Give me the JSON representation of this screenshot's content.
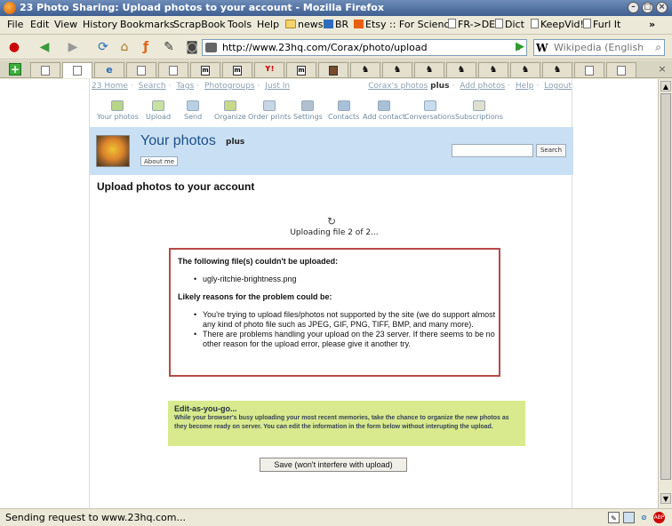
{
  "window": {
    "title": "23 Photo Sharing: Upload photos to your account - Mozilla Firefox",
    "min_glyph": "–",
    "max_glyph": "□",
    "close_glyph": "×"
  },
  "menu": {
    "file": "File",
    "edit": "Edit",
    "view": "View",
    "history": "History",
    "bookmarks": "Bookmarks",
    "scrapbook": "ScrapBook",
    "tools": "Tools",
    "help": "Help",
    "overflow": "»"
  },
  "bookmarks": [
    {
      "label": "news",
      "icon": "folder-icon"
    },
    {
      "label": "BR",
      "icon": "br-icon"
    },
    {
      "label": "Etsy :: For Science",
      "icon": "etsy-icon"
    },
    {
      "label": "FR->DE",
      "icon": "page-icon"
    },
    {
      "label": "Dict",
      "icon": "page-icon"
    },
    {
      "label": "KeepVid!",
      "icon": "page-icon"
    },
    {
      "label": "Furl It",
      "icon": "page-icon"
    }
  ],
  "navigation": {
    "url": "http://www.23hq.com/Corax/photo/upload",
    "search_engine_glyph": "W",
    "search_placeholder": "Wikipedia (English)"
  },
  "tabs": {
    "new_tab_glyph": "+",
    "close_glyph": "×",
    "icons": [
      "page",
      "page",
      "ie",
      "page",
      "page",
      "m",
      "m",
      "y",
      "m",
      "film",
      "dog",
      "dog",
      "dog",
      "dog",
      "dog",
      "dog",
      "dog",
      "page",
      "page"
    ],
    "icon_glyphs": {
      "ie": "e",
      "m": "m",
      "y": "Y!",
      "dog": "♞"
    }
  },
  "site": {
    "toplinks_left": [
      "23 Home",
      "Search",
      "Tags",
      "Photogroups",
      "Just In"
    ],
    "toplinks_right": {
      "user": "Corax's photos",
      "plus": "plus",
      "links": [
        "Add photos",
        "Help",
        "Logout"
      ]
    },
    "nav": [
      {
        "label": "Your photos",
        "icon": "photos-icon",
        "color": "#b9d58a"
      },
      {
        "label": "Upload",
        "icon": "upload-arrow-icon",
        "color": "#c8e0a0"
      },
      {
        "label": "Send",
        "icon": "send-icon",
        "color": "#b9d0e4"
      },
      {
        "label": "Organize",
        "icon": "organize-icon",
        "color": "#c8d88a"
      },
      {
        "label": "Order prints",
        "icon": "prints-icon",
        "color": "#c6d6e6"
      },
      {
        "label": "Settings",
        "icon": "settings-lock-icon",
        "color": "#b0c0d0"
      },
      {
        "label": "Contacts",
        "icon": "contacts-icon",
        "color": "#a8c0d8"
      },
      {
        "label": "Add contact",
        "icon": "add-contact-icon",
        "color": "#a8c0d8"
      },
      {
        "label": "Conversations",
        "icon": "conversations-icon",
        "color": "#c8dcef"
      },
      {
        "label": "Subscriptions",
        "icon": "subscriptions-icon",
        "color": "#e0e0d0"
      }
    ],
    "hero": {
      "title": "Your photos",
      "plus": "plus",
      "about": "About me",
      "search_button": "Search"
    },
    "heading": "Upload photos to your account",
    "spinner_glyph": "↻",
    "progress": "Uploading file 2 of 2...",
    "error": {
      "title": "The following file(s) couldn't be uploaded:",
      "files": [
        "ugly-ritchie-brightness.png"
      ],
      "reasons_title": "Likely reasons for the problem could be:",
      "reasons": [
        "You're trying to upload files/photos not supported by the site (we do support almost any kind of photo file such as JPEG, GIF, PNG, TIFF, BMP, and many more).",
        "There are problems handling your upload on the 23 server. If there seems to be no other reason for the upload error, please give it another try."
      ]
    },
    "edit": {
      "title": "Edit-as-you-go...",
      "body": "While your browser's busy uploading your most recent memories, take the chance to organize the new photos as they become ready on server. You can edit the information in the form below without interupting the upload."
    },
    "save_button": "Save (won't interfere with upload)"
  },
  "status": {
    "text": "Sending request to www.23hq.com...",
    "adblock": "ABP"
  },
  "colors": {
    "hero_bg": "#c9e0f4",
    "error_border": "#b64a4a",
    "edit_bg": "#d9e98e",
    "title_blue": "#1b4f8a"
  }
}
